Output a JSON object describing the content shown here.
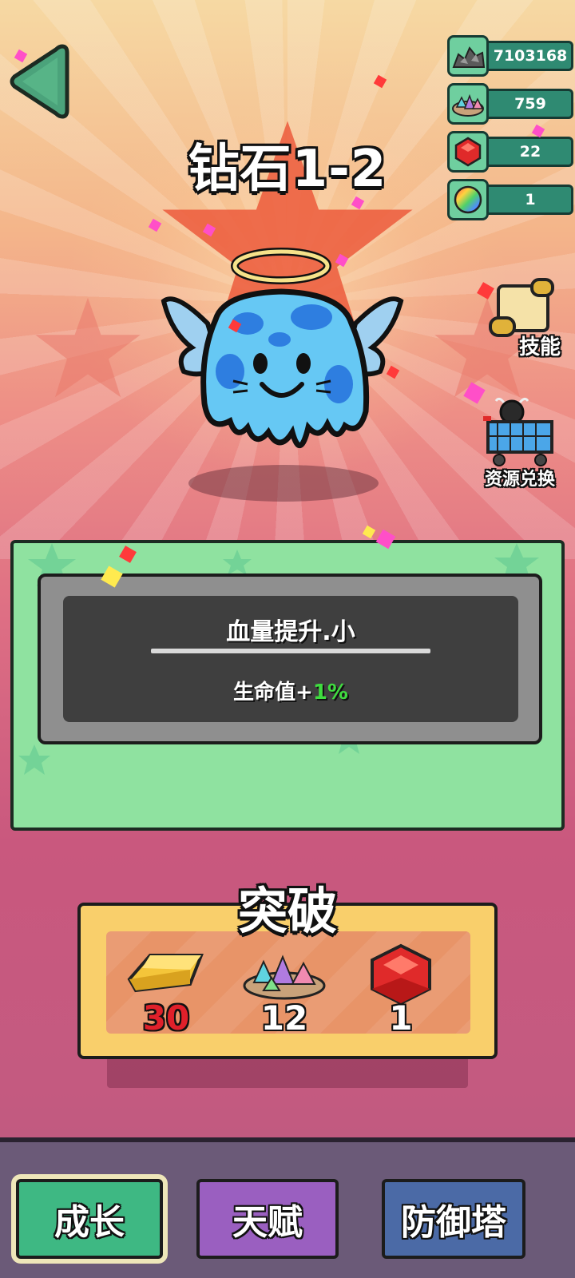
{
  "header": {
    "stage_title": "钻石1-2"
  },
  "resources": [
    {
      "icon": "silver-ore-pile-icon",
      "value": "7103168"
    },
    {
      "icon": "crystal-pile-icon",
      "value": "759"
    },
    {
      "icon": "red-gem-icon",
      "value": "22"
    },
    {
      "icon": "rainbow-orb-icon",
      "value": "1"
    }
  ],
  "side_buttons": {
    "skill_label": "技能",
    "exchange_label": "资源兑换"
  },
  "pet": {
    "name": "angel-blue-slime"
  },
  "info": {
    "buff_name": "血量提升.小",
    "effect_prefix": "生命值+",
    "effect_value": "1%"
  },
  "breakthrough": {
    "title": "突破",
    "costs": [
      {
        "icon": "gold-bar-icon",
        "amount": "30",
        "sufficient": false
      },
      {
        "icon": "crystal-pile-icon",
        "amount": "12",
        "sufficient": true
      },
      {
        "icon": "red-gem-icon",
        "amount": "1",
        "sufficient": true
      }
    ]
  },
  "nav": {
    "tabs": [
      {
        "label": "成长",
        "color": "#3eb883",
        "active": true
      },
      {
        "label": "天赋",
        "color": "#9a5fc0",
        "active": false
      },
      {
        "label": "防御塔",
        "color": "#4b6aa6",
        "active": false
      }
    ]
  }
}
